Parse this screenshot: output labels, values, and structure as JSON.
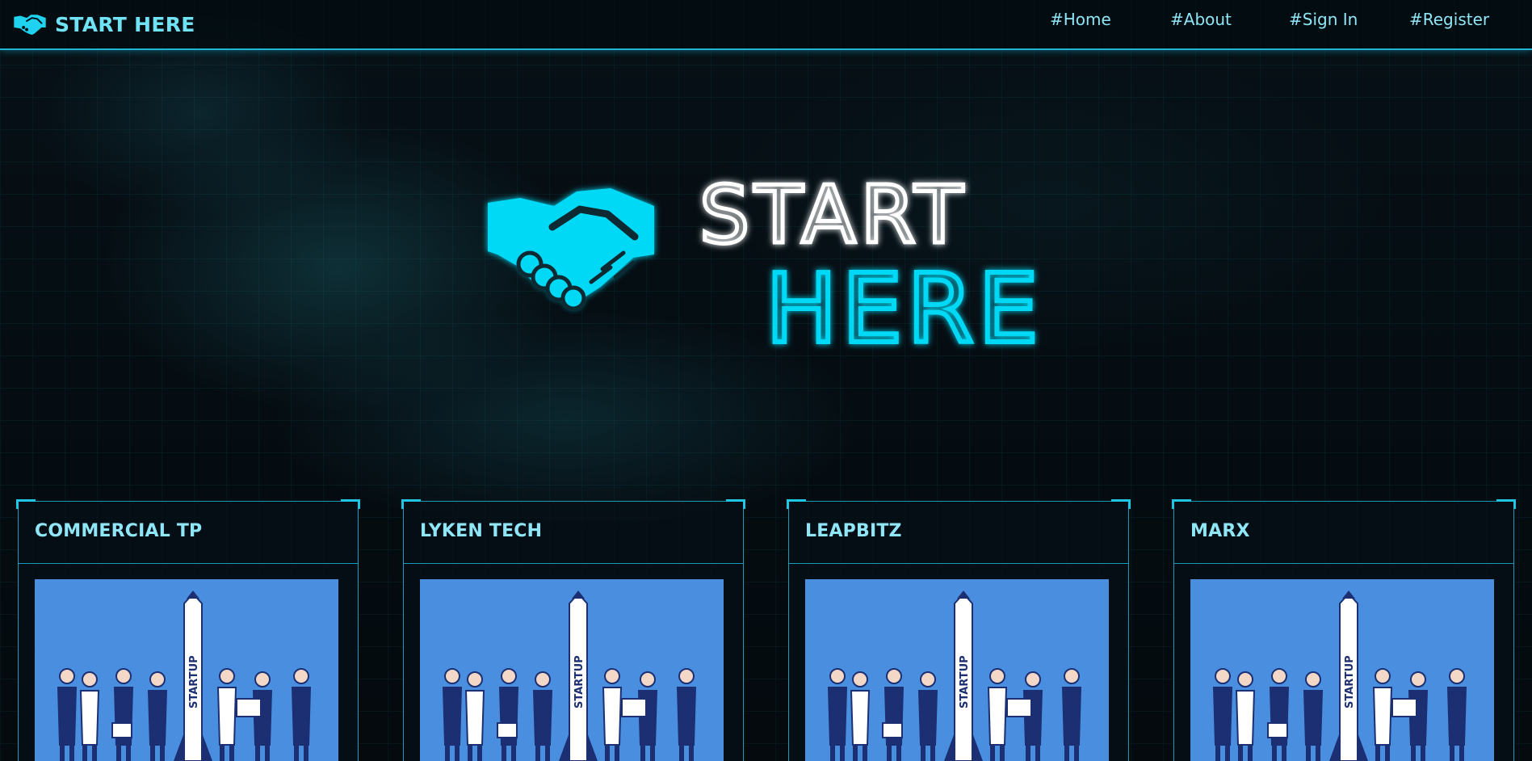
{
  "brand": {
    "name": "START HERE",
    "icon": "handshake-icon"
  },
  "nav": {
    "links": [
      {
        "label": "#Home"
      },
      {
        "label": "#About"
      },
      {
        "label": "#Sign In"
      },
      {
        "label": "#Register"
      }
    ]
  },
  "hero": {
    "line1": "START",
    "line2": "HERE",
    "icon": "handshake-icon"
  },
  "cards": [
    {
      "title": "COMMERCIAL TP",
      "image_text": "STARTUP"
    },
    {
      "title": "LYKEN TECH",
      "image_text": "STARTUP"
    },
    {
      "title": "LEAPBITZ",
      "image_text": "STARTUP"
    },
    {
      "title": "MARX",
      "image_text": "STARTUP"
    }
  ],
  "colors": {
    "accent": "#00d9f5",
    "nav_text": "#8fe6f7",
    "border": "#1a9cb8",
    "card_image_bg": "#4a8fdf",
    "background": "#050b0f"
  }
}
